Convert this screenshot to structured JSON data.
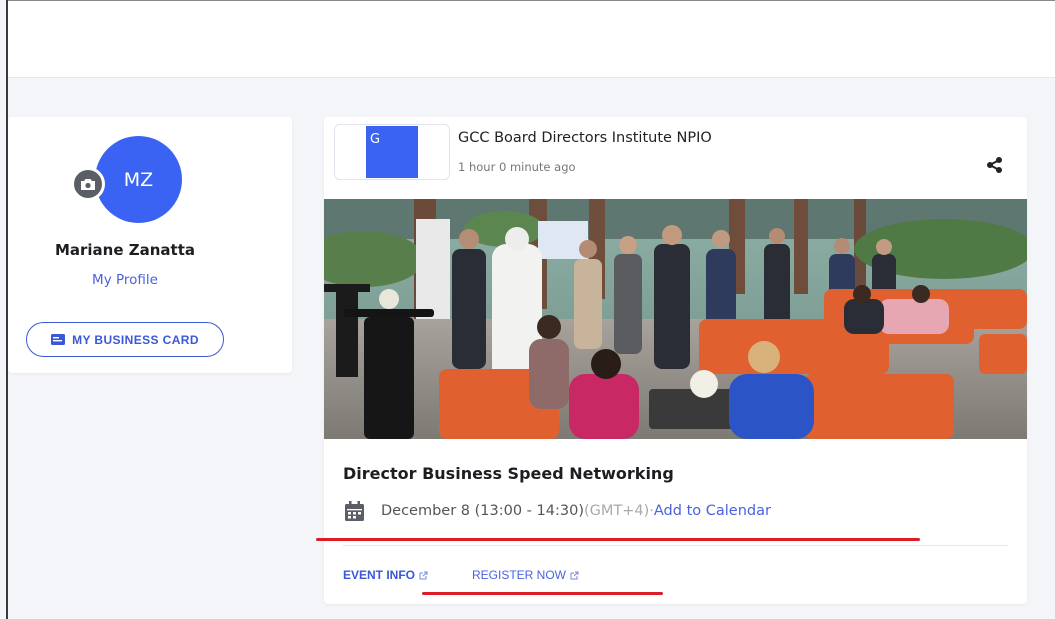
{
  "profile": {
    "initials": "MZ",
    "name": "Mariane Zanatta",
    "my_profile_label": "My Profile",
    "business_card_label": "MY BUSINESS CARD"
  },
  "post": {
    "org_logo_letter": "G",
    "org_name": "GCC Board Directors Institute NPIO",
    "time_ago": "1 hour 0 minute ago",
    "event": {
      "title": "Director Business Speed Networking",
      "date": "December 8 (13:00 - 14:30)",
      "timezone": "(GMT+4)",
      "separator": "·",
      "add_to_calendar": "Add to Calendar"
    },
    "actions": {
      "event_info": "EVENT INFO",
      "register_now": "REGISTER NOW"
    }
  },
  "colors": {
    "accent": "#3b63f3",
    "link": "#4b62de",
    "annotation_red": "#d91e26"
  }
}
